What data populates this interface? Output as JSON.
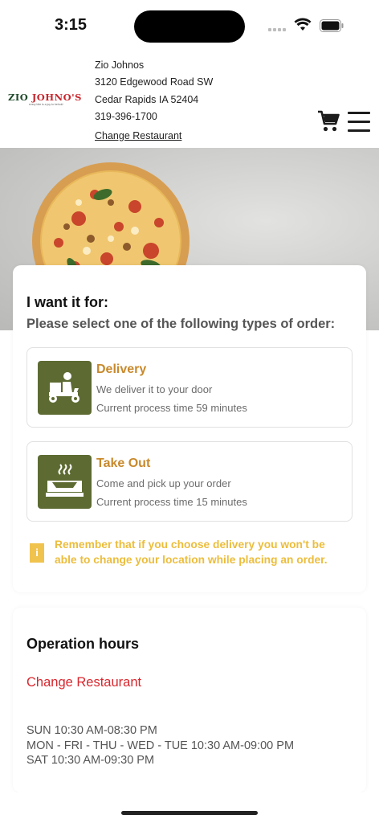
{
  "status_bar": {
    "time": "3:15"
  },
  "restaurant": {
    "logo_text_a": "ZIO",
    "logo_text_b": "JOHNO'S",
    "logo_tagline": "every bite is a joy to behold",
    "name": "Zio Johnos",
    "street": "3120 Edgewood Road SW",
    "city": "Cedar Rapids IA 52404",
    "phone": "319-396-1700",
    "change_label": "Change Restaurant"
  },
  "header_icons": [
    "cart-icon",
    "hamburger-menu-icon"
  ],
  "order": {
    "heading": "I want it for:",
    "subheading": "Please select one of the following types of order:",
    "options": [
      {
        "title": "Delivery",
        "description": "We deliver it to your door",
        "process_time": "Current process time 59 minutes",
        "icon": "delivery-scooter-icon"
      },
      {
        "title": "Take Out",
        "description": "Come and pick up your order",
        "process_time": "Current process time 15 minutes",
        "icon": "takeout-box-icon"
      }
    ],
    "notice_icon": "i",
    "notice": "Remember that if you choose delivery you won't be able to change your location while placing an order."
  },
  "hours": {
    "title": "Operation hours",
    "change_label": "Change Restaurant",
    "lines": [
      "SUN  10:30 AM-08:30 PM",
      "MON - FRI - THU - WED - TUE  10:30 AM-09:00 PM",
      "SAT  10:30 AM-09:30 PM"
    ]
  },
  "colors": {
    "accent_gold": "#c8892c",
    "icon_green": "#5d6b32",
    "notice_yellow": "#ecbd3c",
    "link_red": "#d8262d"
  }
}
